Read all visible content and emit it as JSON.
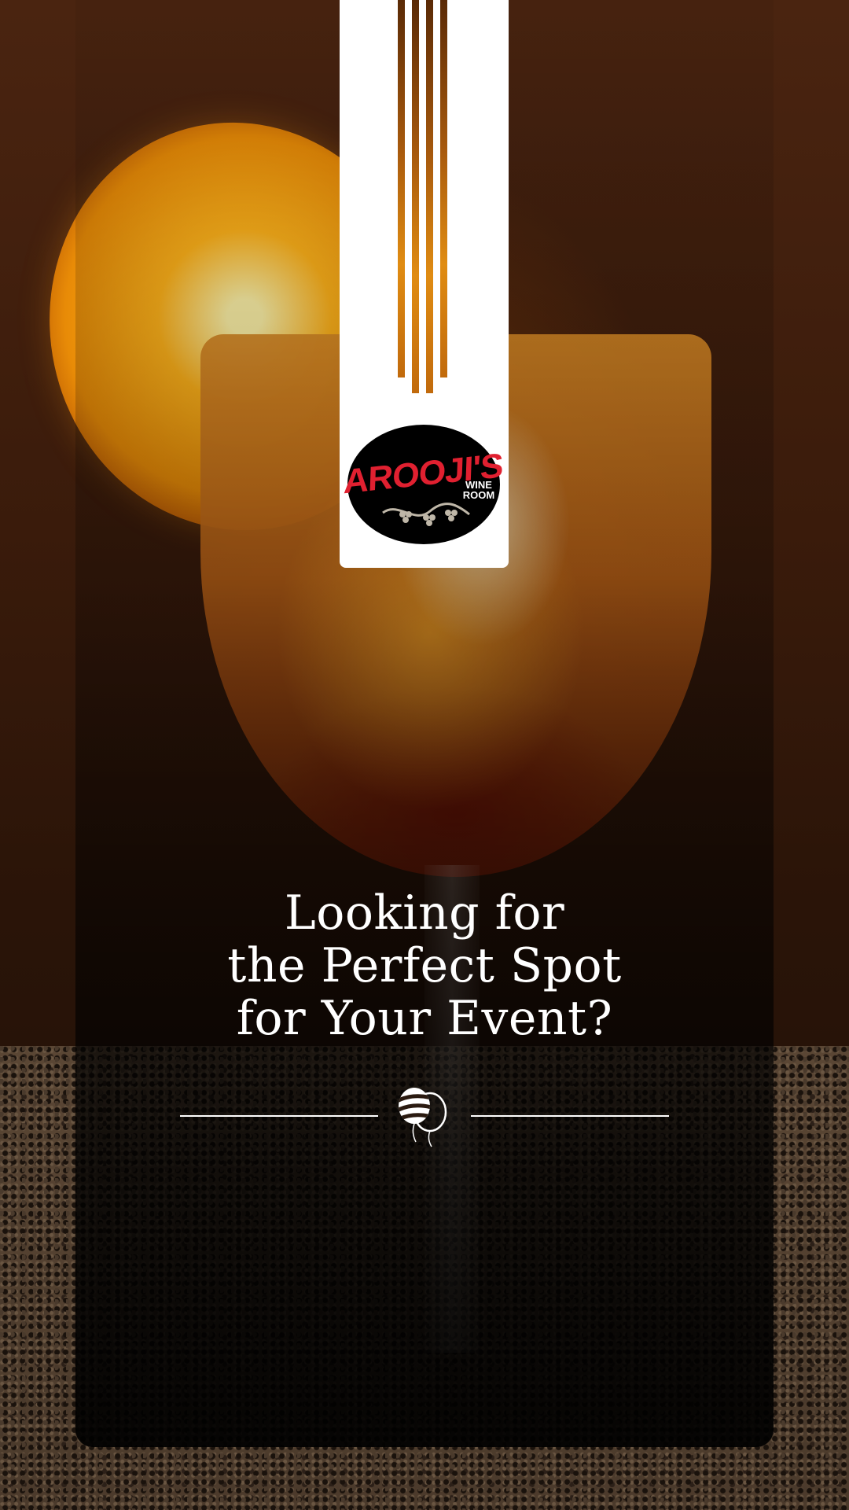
{
  "brand": {
    "logo_main": "AROOJI'S",
    "logo_sub_line1": "WINE",
    "logo_sub_line2": "ROOM"
  },
  "headline": {
    "line1": "Looking for",
    "line2": "the Perfect Spot",
    "line3": "for Your Event?"
  },
  "icons": {
    "divider_icon": "balloons-icon"
  },
  "colors": {
    "card_overlay": "#000000",
    "ribbon": "#ffffff",
    "logo_red": "#e02030",
    "stripe_amber": "#c16a0c",
    "text": "#ffffff"
  }
}
